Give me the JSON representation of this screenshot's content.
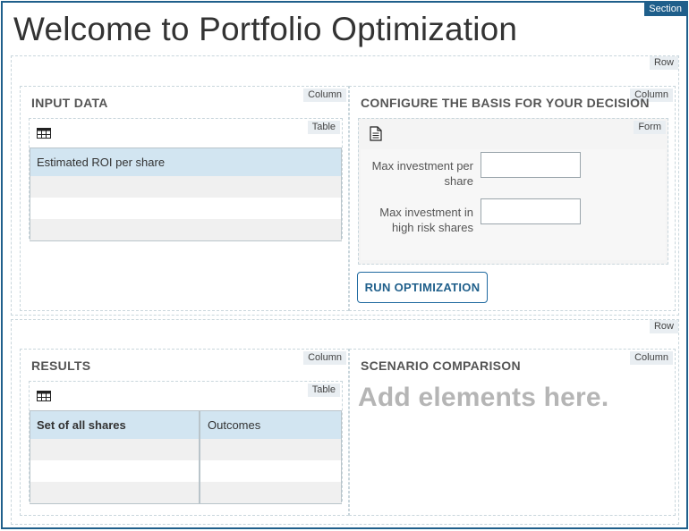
{
  "section": {
    "tag": "Section"
  },
  "page": {
    "title": "Welcome to Portfolio Optimization"
  },
  "rows": [
    {
      "tag": "Row",
      "columns": [
        {
          "tag": "Column",
          "heading": "INPUT DATA",
          "table": {
            "tag": "Table",
            "icon": "table-icon",
            "header": [
              "Estimated ROI per share"
            ],
            "body_rows": 3
          }
        },
        {
          "tag": "Column",
          "heading": "CONFIGURE THE BASIS FOR YOUR DECISION",
          "form": {
            "tag": "Form",
            "icon": "document-icon",
            "fields": [
              {
                "label": "Max investment per share",
                "value": ""
              },
              {
                "label": "Max investment in high risk shares",
                "value": ""
              }
            ]
          },
          "run_button": "RUN OPTIMIZATION"
        }
      ]
    },
    {
      "tag": "Row",
      "columns": [
        {
          "tag": "Column",
          "heading": "RESULTS",
          "table": {
            "tag": "Table",
            "icon": "table-icon",
            "header": [
              "Set of all shares",
              "Outcomes"
            ],
            "body_rows": 3
          }
        },
        {
          "tag": "Column",
          "heading": "SCENARIO COMPARISON",
          "placeholder": "Add elements here."
        }
      ]
    }
  ],
  "colors": {
    "accent": "#1f5f8b",
    "table_header": "#d2e5f1",
    "placeholder_text": "#b5b5b5"
  }
}
